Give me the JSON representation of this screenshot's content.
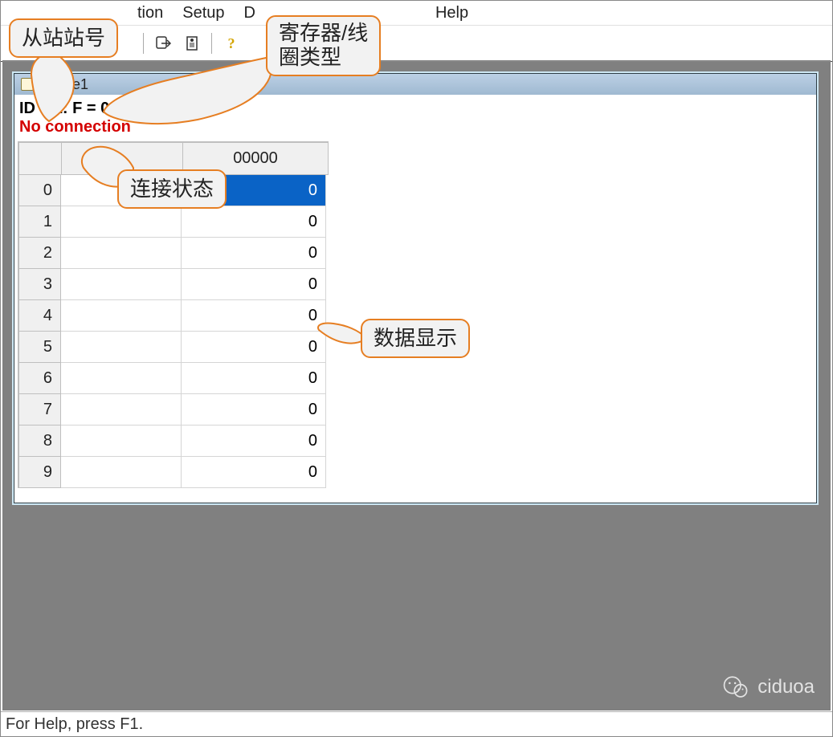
{
  "menu": {
    "items_partial": {
      "connection_suffix": "tion",
      "setup": "Setup",
      "display_prefix": "D",
      "help": "Help"
    }
  },
  "toolbar": {
    "icons": {
      "disconnect": "disconnect-icon",
      "auto": "auto-icon",
      "help": "help-icon"
    }
  },
  "child_window": {
    "title": "bslave1",
    "id_line": "ID = 1: F = 03",
    "connection_status": "No connection",
    "table": {
      "col_header_value": "00000",
      "rows": [
        {
          "index": "0",
          "value": "0",
          "selected": true
        },
        {
          "index": "1",
          "value": "0",
          "selected": false
        },
        {
          "index": "2",
          "value": "0",
          "selected": false
        },
        {
          "index": "3",
          "value": "0",
          "selected": false
        },
        {
          "index": "4",
          "value": "0",
          "selected": false
        },
        {
          "index": "5",
          "value": "0",
          "selected": false
        },
        {
          "index": "6",
          "value": "0",
          "selected": false
        },
        {
          "index": "7",
          "value": "0",
          "selected": false
        },
        {
          "index": "8",
          "value": "0",
          "selected": false
        },
        {
          "index": "9",
          "value": "0",
          "selected": false
        }
      ]
    }
  },
  "statusbar": {
    "text": "For Help, press F1."
  },
  "annotations": {
    "slave_id": "从站站号",
    "register_type": "寄存器/线\n圈类型",
    "connection_state": "连接状态",
    "data_display": "数据显示"
  },
  "watermark": {
    "text": "ciduoa"
  }
}
